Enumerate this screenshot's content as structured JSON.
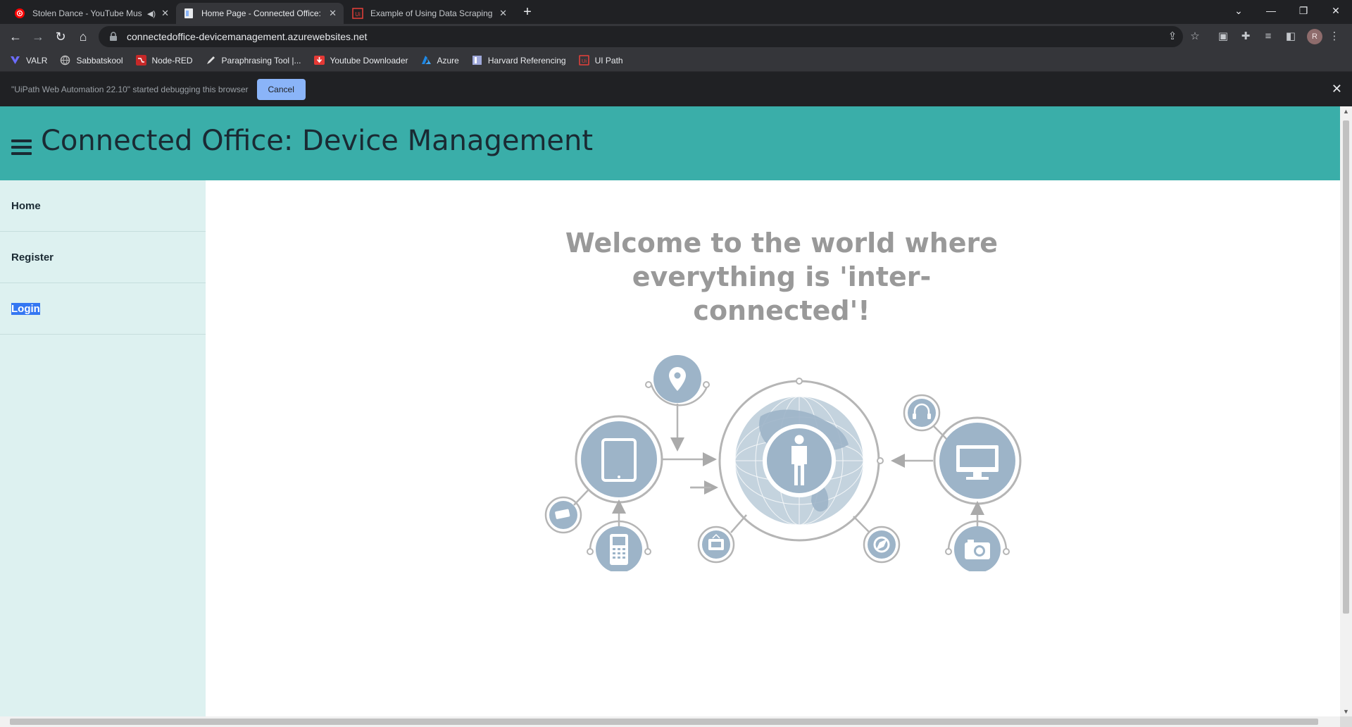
{
  "tabs": [
    {
      "title": "Stolen Dance - YouTube Mus",
      "favicon": "youtube-music-icon",
      "color": "#ff0000"
    },
    {
      "title": "Home Page - Connected Office: D",
      "favicon": "document-icon",
      "color": "#8ab4f8"
    },
    {
      "title": "Example of Using Data Scraping",
      "favicon": "uipath-icon",
      "color": "#e8413a"
    }
  ],
  "address_bar": {
    "url": "connectedoffice-devicemanagement.azurewebsites.net"
  },
  "bookmarks": [
    {
      "label": "VALR",
      "icon": "valr-icon",
      "color": "#6c6cff"
    },
    {
      "label": "Sabbatskool",
      "icon": "globe-icon",
      "color": "#bdbdbd"
    },
    {
      "label": "Node-RED",
      "icon": "node-red-icon",
      "color": "#c62828"
    },
    {
      "label": "Paraphrasing Tool |...",
      "icon": "pen-icon",
      "color": "#e0e0e0"
    },
    {
      "label": "Youtube Downloader",
      "icon": "download-icon",
      "color": "#e53935"
    },
    {
      "label": "Azure",
      "icon": "azure-icon",
      "color": "#1e88e5"
    },
    {
      "label": "Harvard Referencing",
      "icon": "bookmark-book-icon",
      "color": "#9fa8da"
    },
    {
      "label": "UI Path",
      "icon": "uipath-icon",
      "color": "#e8413a"
    }
  ],
  "debug_bar": {
    "message": "\"UiPath Web Automation 22.10\" started debugging this browser",
    "cancel_label": "Cancel"
  },
  "profile": {
    "initial": "R"
  },
  "site": {
    "title": "Connected Office: Device Management",
    "nav": [
      "Home",
      "Register",
      "Login"
    ],
    "selected_nav": "Login",
    "welcome_line1": "Welcome to the world where",
    "welcome_line2": "everything is 'inter-connected'!"
  },
  "colors": {
    "header": "#3aaea9",
    "sidebar": "#ddf1f0",
    "icon_fill": "#9db4c8",
    "ring": "#b5b5b5"
  }
}
